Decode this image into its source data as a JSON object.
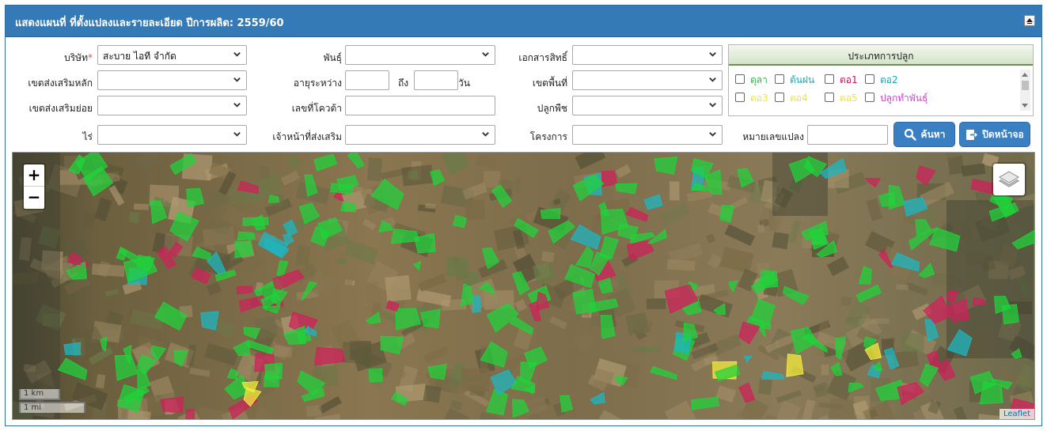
{
  "header": {
    "title": "แสดงแผนที่ ที่ตั้งแปลงและรายละเอียด ปีการผลิต: 2559/60"
  },
  "form": {
    "company": {
      "label": "บริษัท",
      "required_mark": "*",
      "value": "สะบาย ไอที จำกัด"
    },
    "zone_main": {
      "label": "เขตส่งเสริมหลัก",
      "value": ""
    },
    "zone_sub": {
      "label": "เขตส่งเสริมย่อย",
      "value": ""
    },
    "rai": {
      "label": "ไร่",
      "value": ""
    },
    "variety": {
      "label": "พันธุ์",
      "value": ""
    },
    "age": {
      "label": "อายุระหว่าง",
      "to_label": "ถึง",
      "unit": "วัน",
      "from_value": "",
      "to_value": ""
    },
    "quota": {
      "label": "เลขที่โควต้า",
      "value": ""
    },
    "officer": {
      "label": "เจ้าหน้าที่ส่งเสริม",
      "value": ""
    },
    "title_deed": {
      "label": "เอกสารสิทธิ์",
      "value": ""
    },
    "area_zone": {
      "label": "เขตพื้นที่",
      "value": ""
    },
    "crop": {
      "label": "ปลูกพืช",
      "value": ""
    },
    "project": {
      "label": "โครงการ",
      "value": ""
    },
    "plot_no": {
      "label": "หมายเลขแปลง",
      "value": ""
    }
  },
  "planting_type": {
    "header": "ประเภทการปลูก",
    "options": [
      {
        "label": "ตุลา",
        "color": "#2eb84a"
      },
      {
        "label": "ต้นฝน",
        "color": "#1aa7b8"
      },
      {
        "label": "ตอ1",
        "color": "#c2185b"
      },
      {
        "label": "ตอ2",
        "color": "#1aa7b8"
      },
      {
        "label": "ตอ3",
        "color": "#f4e23a"
      },
      {
        "label": "ตอ4",
        "color": "#f4e23a"
      },
      {
        "label": "ตอ5",
        "color": "#f4e23a"
      },
      {
        "label": "ปลูกทำพันธุ์",
        "color": "#d63fd6"
      }
    ]
  },
  "buttons": {
    "search": {
      "label": "ค้นหา",
      "icon": "search-icon"
    },
    "close": {
      "label": "ปิดหน้าจอ",
      "icon": "exit-icon"
    }
  },
  "map": {
    "zoom_in": "+",
    "zoom_out": "−",
    "scale_km": "1 km",
    "scale_mi": "1 mi",
    "attribution": "Leaflet",
    "colors": {
      "field_green": "#1fd43a",
      "field_red": "#d0205a",
      "field_cyan": "#1ab8c4",
      "field_yellow": "#f6f03a"
    }
  }
}
